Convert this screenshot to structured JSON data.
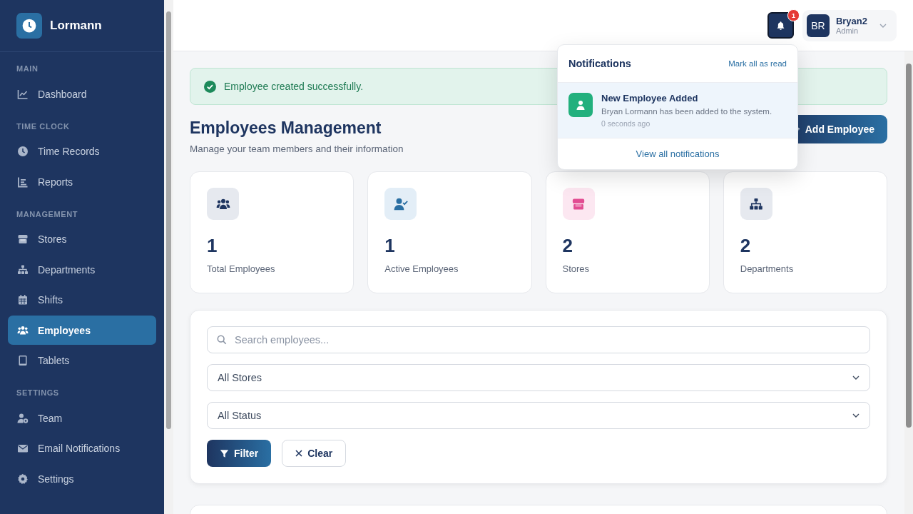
{
  "sidebar": {
    "brand": "Lormann",
    "sections": [
      {
        "title": "MAIN",
        "items": [
          {
            "label": "Dashboard",
            "selected": false
          }
        ]
      },
      {
        "title": "TIME CLOCK",
        "items": [
          {
            "label": "Time Records",
            "selected": false
          },
          {
            "label": "Reports",
            "selected": false
          }
        ]
      },
      {
        "title": "MANAGEMENT",
        "items": [
          {
            "label": "Stores",
            "selected": false
          },
          {
            "label": "Departments",
            "selected": false
          },
          {
            "label": "Shifts",
            "selected": false
          },
          {
            "label": "Employees",
            "selected": true
          },
          {
            "label": "Tablets",
            "selected": false
          }
        ]
      },
      {
        "title": "SETTINGS",
        "items": [
          {
            "label": "Team",
            "selected": false
          },
          {
            "label": "Email Notifications",
            "selected": false
          },
          {
            "label": "Settings",
            "selected": false
          }
        ]
      }
    ]
  },
  "header": {
    "notification_count": "1",
    "user": {
      "initials": "BR",
      "name": "Bryan2",
      "role": "Admin"
    }
  },
  "notification_panel": {
    "title": "Notifications",
    "action": "Mark all as read",
    "items": [
      {
        "title": "New Employee Added",
        "message": "Bryan Lormann has been added to the system.",
        "time": "0 seconds ago",
        "unread": true
      }
    ],
    "footer": "View all notifications"
  },
  "alert": {
    "message": "Employee created successfully."
  },
  "page": {
    "title": "Employees Management",
    "subtitle": "Manage your team members and their information",
    "add_button": "Add Employee"
  },
  "stats": [
    {
      "value": "1",
      "label": "Total Employees"
    },
    {
      "value": "1",
      "label": "Active Employees"
    },
    {
      "value": "2",
      "label": "Stores"
    },
    {
      "value": "2",
      "label": "Departments"
    }
  ],
  "filters": {
    "search": {
      "placeholder": "Search employees..."
    },
    "selects": [
      {
        "value": "All Stores"
      },
      {
        "value": "All Status"
      }
    ],
    "buttons": [
      {
        "label": "Filter",
        "kind": "primary"
      },
      {
        "label": "Clear",
        "kind": "secondary"
      }
    ]
  }
}
